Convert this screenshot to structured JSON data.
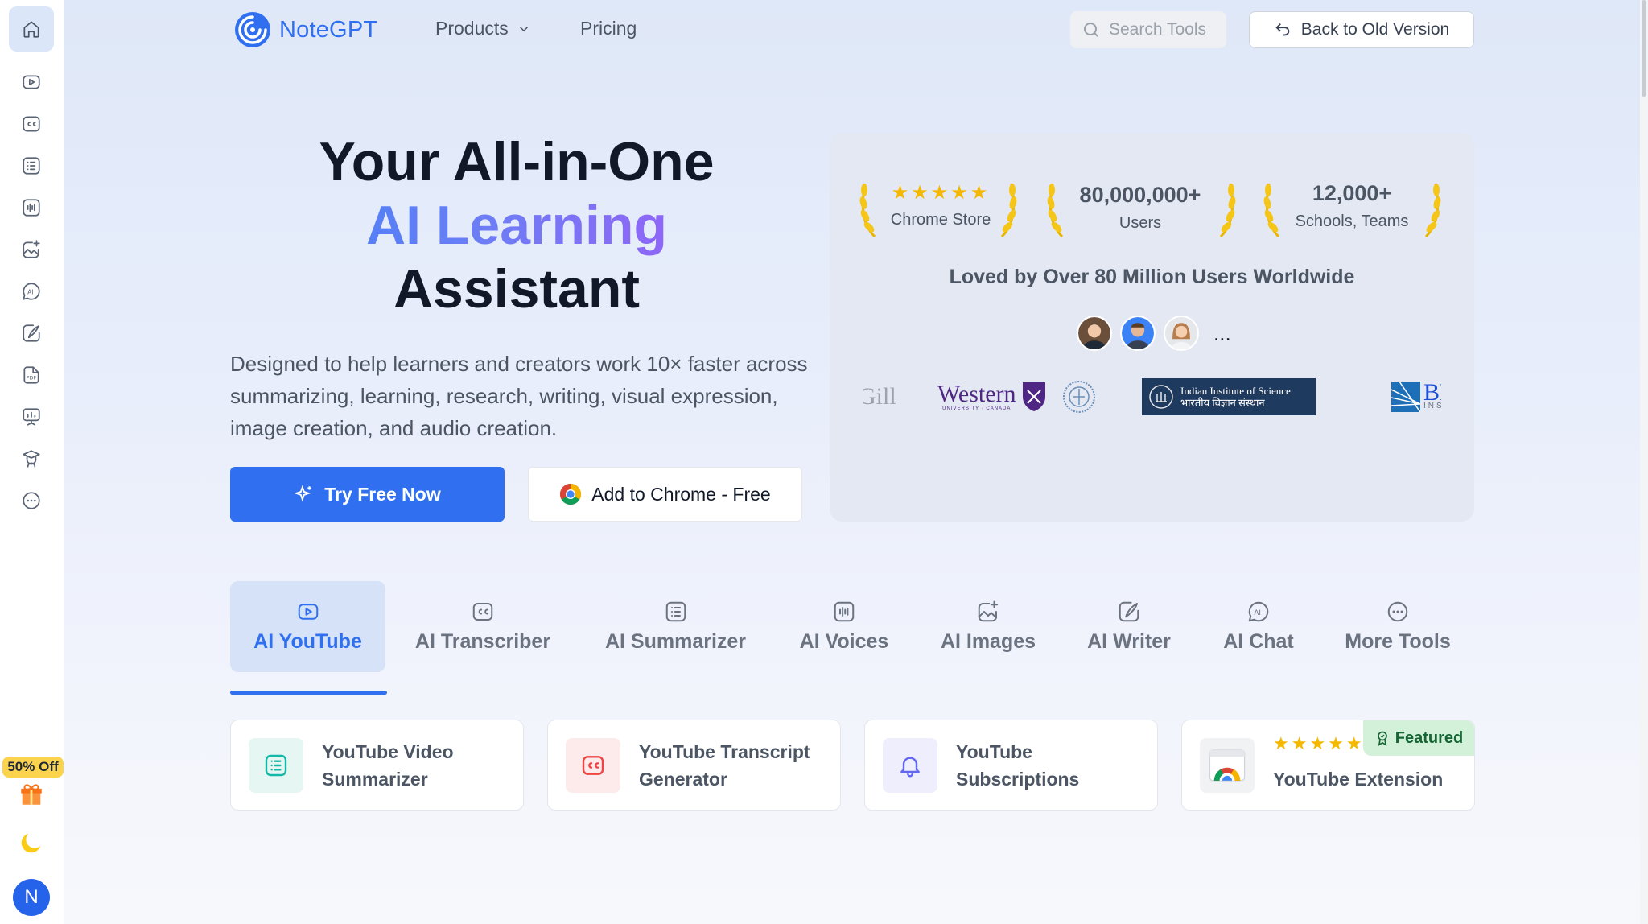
{
  "brand": {
    "name": "NoteGPT",
    "accent": "#2f6ff0"
  },
  "nav": {
    "products_label": "Products",
    "pricing_label": "Pricing",
    "search_placeholder": "Search Tools",
    "back_label": "Back to Old Version"
  },
  "sidebar": {
    "items": [
      {
        "icon": "home-icon",
        "active": true
      },
      {
        "icon": "youtube-play-icon"
      },
      {
        "icon": "closed-captions-icon"
      },
      {
        "icon": "list-icon"
      },
      {
        "icon": "audio-wave-icon"
      },
      {
        "icon": "image-sparkle-icon"
      },
      {
        "icon": "ai-chat-icon"
      },
      {
        "icon": "pen-writer-icon"
      },
      {
        "icon": "pdf-icon"
      },
      {
        "icon": "presentation-icon"
      },
      {
        "icon": "graduation-icon"
      },
      {
        "icon": "more-icon"
      }
    ],
    "promo": "50% Off",
    "user_initial": "N"
  },
  "hero": {
    "title_line1": "Your All-in-One",
    "title_line2": "AI Learning",
    "title_line3": "Assistant",
    "description": "Designed to help learners and creators work 10× faster across summarizing, learning, research, writing, visual expression, image creation, and audio creation.",
    "try_label": "Try Free Now",
    "chrome_label": "Add to Chrome  - Free"
  },
  "stats": {
    "chrome_store": {
      "rating": 5,
      "label": "Chrome Store"
    },
    "users": {
      "value": "80,000,000+",
      "label": "Users"
    },
    "schools": {
      "value": "12,000+",
      "label": "Schools, Teams"
    },
    "loved": "Loved by Over 80 Million Users Worldwide",
    "more": "...",
    "universities": {
      "mcgill": "Gill",
      "western": "Western",
      "western_sub": "UNIVERSITY · CANADA",
      "iisc_en": "Indian Institute of Science",
      "iisc_hi": "भारतीय विज्ञान संस्थान",
      "bro": "BRO",
      "bro_sub": "INST"
    }
  },
  "tabs": [
    {
      "label": "AI YouTube",
      "icon": "youtube-play-icon",
      "active": true
    },
    {
      "label": "AI Transcriber",
      "icon": "closed-captions-icon"
    },
    {
      "label": "AI Summarizer",
      "icon": "list-icon"
    },
    {
      "label": "AI Voices",
      "icon": "audio-wave-icon"
    },
    {
      "label": "AI Images",
      "icon": "image-sparkle-icon"
    },
    {
      "label": "AI Writer",
      "icon": "pen-writer-icon"
    },
    {
      "label": "AI Chat",
      "icon": "ai-chat-icon"
    },
    {
      "label": "More Tools",
      "icon": "more-icon"
    }
  ],
  "cards": [
    {
      "title": "YouTube Video Summarizer",
      "icon": "list-icon",
      "color": "#14b8a6"
    },
    {
      "title": "YouTube Transcript Generator",
      "icon": "closed-captions-icon",
      "color": "#ef4444"
    },
    {
      "title": "YouTube Subscriptions",
      "icon": "bell-icon",
      "color": "#6366f1"
    },
    {
      "title": "YouTube Extension",
      "icon": "chrome-icon",
      "rating": 5,
      "badge": "Featured"
    }
  ]
}
